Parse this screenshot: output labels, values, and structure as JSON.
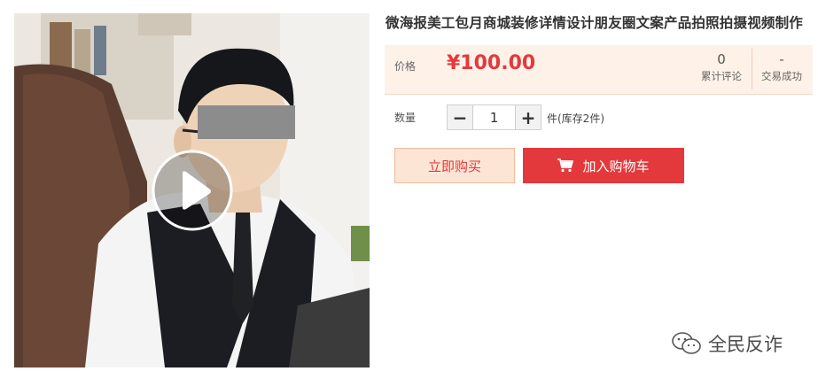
{
  "product": {
    "title": "微海报美工包月商城装修详情设计朋友圈文案产品拍照拍摄视频制作"
  },
  "price": {
    "label": "价格",
    "value": "¥100.00"
  },
  "stats": {
    "reviews_count": "0",
    "reviews_label": "累计评论",
    "deals_count": "-",
    "deals_label": "交易成功"
  },
  "quantity": {
    "label": "数量",
    "minus": "−",
    "value": "1",
    "plus": "+",
    "stock": "件(库存2件)"
  },
  "actions": {
    "buy_now": "立即购买",
    "add_to_cart": "加入购物车"
  },
  "watermark": {
    "text": "全民反诈"
  },
  "icons": {
    "play": "play-icon",
    "cart": "cart-icon",
    "wechat": "wechat-icon"
  },
  "colors": {
    "accent_red": "#e4393c",
    "price_bg": "#fdf1e8",
    "buy_bg": "#fde5d6"
  }
}
